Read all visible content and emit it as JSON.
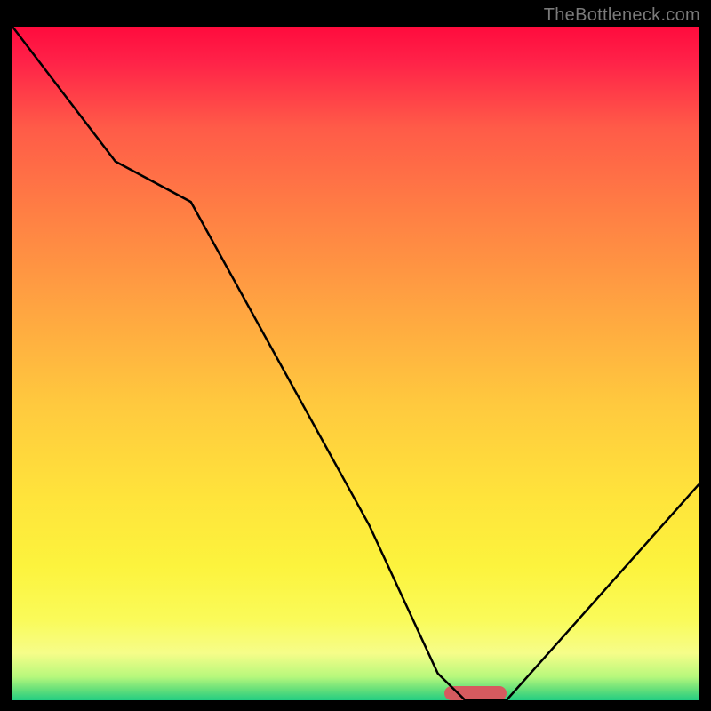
{
  "watermark": "TheBottleneck.com",
  "chart_data": {
    "type": "line",
    "title": "",
    "xlabel": "",
    "ylabel": "",
    "xlim": [
      0,
      100
    ],
    "ylim": [
      0,
      100
    ],
    "series": [
      {
        "name": "curve",
        "x": [
          0,
          15,
          26,
          52,
          62,
          66,
          72,
          100
        ],
        "values": [
          100,
          80,
          74,
          26,
          4,
          0,
          0,
          32
        ]
      }
    ],
    "marker": {
      "x_start": 63,
      "x_end": 72,
      "y": 1
    },
    "background_gradient": {
      "stops": [
        {
          "pos": 0,
          "color": "#ff0b3d"
        },
        {
          "pos": 0.15,
          "color": "#ff5b48"
        },
        {
          "pos": 0.42,
          "color": "#ffa541"
        },
        {
          "pos": 0.7,
          "color": "#ffe43b"
        },
        {
          "pos": 0.88,
          "color": "#fafb59"
        },
        {
          "pos": 0.97,
          "color": "#b7f87c"
        },
        {
          "pos": 1.0,
          "color": "#22cd82"
        }
      ]
    }
  }
}
